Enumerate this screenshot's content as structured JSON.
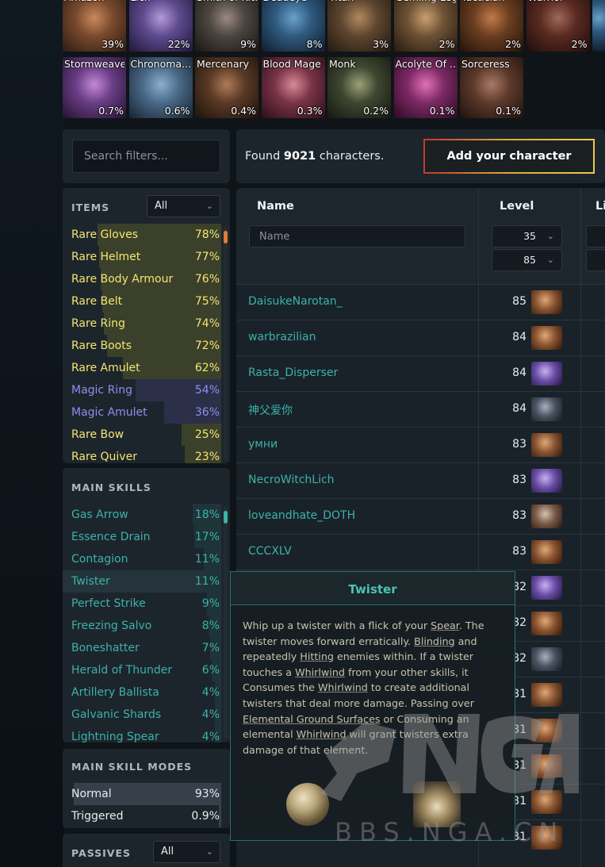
{
  "classes_row1": [
    {
      "name": "Amazon",
      "pct": "39%"
    },
    {
      "name": "Lich",
      "pct": "22%"
    },
    {
      "name": "Smith of Kitava",
      "pct": "9%"
    },
    {
      "name": "Deadeye",
      "pct": "8%"
    },
    {
      "name": "Titan",
      "pct": "3%"
    },
    {
      "name": "Gemling Legionnaire",
      "pct": "2%"
    },
    {
      "name": "Tactician",
      "pct": "2%"
    },
    {
      "name": "Warrior",
      "pct": "2%"
    }
  ],
  "classes_row2": [
    {
      "name": "Stormweaver",
      "pct": "0.7%"
    },
    {
      "name": "Chronoma...",
      "pct": "0.6%"
    },
    {
      "name": "Mercenary",
      "pct": "0.4%"
    },
    {
      "name": "Blood Mage",
      "pct": "0.3%"
    },
    {
      "name": "Monk",
      "pct": "0.2%"
    },
    {
      "name": "Acolyte Of ...",
      "pct": "0.1%"
    },
    {
      "name": "Sorceress",
      "pct": "0.1%"
    }
  ],
  "search": {
    "placeholder": "Search filters..."
  },
  "found": {
    "prefix": "Found ",
    "count": "9021",
    "suffix": " characters."
  },
  "add_button": "Add your character",
  "items": {
    "title": "ITEMS",
    "filter": "All",
    "rows": [
      {
        "label": "Rare Gloves",
        "value": "78%",
        "pct": 78,
        "kind": "rare"
      },
      {
        "label": "Rare Helmet",
        "value": "77%",
        "pct": 77,
        "kind": "rare"
      },
      {
        "label": "Rare Body Armour",
        "value": "76%",
        "pct": 76,
        "kind": "rare"
      },
      {
        "label": "Rare Belt",
        "value": "75%",
        "pct": 75,
        "kind": "rare"
      },
      {
        "label": "Rare Ring",
        "value": "74%",
        "pct": 74,
        "kind": "rare"
      },
      {
        "label": "Rare Boots",
        "value": "72%",
        "pct": 72,
        "kind": "rare"
      },
      {
        "label": "Rare Amulet",
        "value": "62%",
        "pct": 62,
        "kind": "rare"
      },
      {
        "label": "Magic Ring",
        "value": "54%",
        "pct": 54,
        "kind": "magic"
      },
      {
        "label": "Magic Amulet",
        "value": "36%",
        "pct": 36,
        "kind": "magic"
      },
      {
        "label": "Rare Bow",
        "value": "25%",
        "pct": 25,
        "kind": "rare"
      },
      {
        "label": "Rare Quiver",
        "value": "23%",
        "pct": 23,
        "kind": "rare"
      }
    ]
  },
  "main_skills": {
    "title": "MAIN SKILLS",
    "rows": [
      {
        "label": "Gas Arrow",
        "value": "18%",
        "pct": 18
      },
      {
        "label": "Essence Drain",
        "value": "17%",
        "pct": 17
      },
      {
        "label": "Contagion",
        "value": "11%",
        "pct": 11
      },
      {
        "label": "Twister",
        "value": "11%",
        "pct": 11
      },
      {
        "label": "Perfect Strike",
        "value": "9%",
        "pct": 9
      },
      {
        "label": "Freezing Salvo",
        "value": "8%",
        "pct": 8
      },
      {
        "label": "Boneshatter",
        "value": "7%",
        "pct": 7
      },
      {
        "label": "Herald of Thunder",
        "value": "6%",
        "pct": 6
      },
      {
        "label": "Artillery Ballista",
        "value": "4%",
        "pct": 4
      },
      {
        "label": "Galvanic Shards",
        "value": "4%",
        "pct": 4
      },
      {
        "label": "Lightning Spear",
        "value": "4%",
        "pct": 4
      }
    ]
  },
  "modes": {
    "title": "MAIN SKILL MODES",
    "rows": [
      {
        "label": "Normal",
        "value": "93%",
        "pct": 93
      },
      {
        "label": "Triggered",
        "value": "0.9%",
        "pct": 0.9
      }
    ]
  },
  "passives": {
    "title": "PASSIVES",
    "filter": "All"
  },
  "table": {
    "col_name": "Name",
    "col_level": "Level",
    "col_life": "Li",
    "name_placeholder": "Name",
    "level_min": "35",
    "level_max": "85",
    "rows": [
      {
        "name": "DaisukeNarotan_",
        "level": "85",
        "avatar": "warrior"
      },
      {
        "name": "warbrazilian",
        "level": "84",
        "avatar": "warrior"
      },
      {
        "name": "Rasta_Disperser",
        "level": "84",
        "avatar": "lich"
      },
      {
        "name": "神父爱你",
        "level": "84",
        "avatar": "smith"
      },
      {
        "name": "умни",
        "level": "83",
        "avatar": "warrior"
      },
      {
        "name": "NecroWitchLich",
        "level": "83",
        "avatar": "lich"
      },
      {
        "name": "loveandhate_DOTH",
        "level": "83",
        "avatar": "monk"
      },
      {
        "name": "CCCXLV",
        "level": "83",
        "avatar": "warrior"
      },
      {
        "name": "",
        "level": "82",
        "avatar": "lich"
      },
      {
        "name": "",
        "level": "82",
        "avatar": "warrior"
      },
      {
        "name": "",
        "level": "82",
        "avatar": "smith"
      },
      {
        "name": "",
        "level": "81",
        "avatar": "warrior"
      },
      {
        "name": "",
        "level": "81",
        "avatar": "warrior"
      },
      {
        "name": "",
        "level": "81",
        "avatar": "warrior"
      },
      {
        "name": "",
        "level": "81",
        "avatar": "warrior"
      },
      {
        "name": "",
        "level": "81",
        "avatar": "warrior"
      }
    ]
  },
  "tooltip": {
    "title": "Twister",
    "segments": [
      {
        "t": "Whip up a twister with a flick of your "
      },
      {
        "t": "Spear",
        "u": true
      },
      {
        "t": ". The twister moves forward erratically. "
      },
      {
        "t": "Blinding",
        "u": true
      },
      {
        "t": " and repeatedly "
      },
      {
        "t": "Hitting",
        "u": true
      },
      {
        "t": " enemies within. If a twister touches a "
      },
      {
        "t": "Whirlwind",
        "u": true
      },
      {
        "t": " from your other skills, it Consumes the "
      },
      {
        "t": "Whirlwind",
        "u": true
      },
      {
        "t": " to create additional twisters that deal more damage. Passing over "
      },
      {
        "t": "Elemental Ground Surfaces",
        "u": true
      },
      {
        "t": " or Consuming an elemental "
      },
      {
        "t": "Whirlwind",
        "u": true
      },
      {
        "t": " will grant twisters extra damage of that element."
      }
    ]
  },
  "watermark": {
    "text": "BBS.NGA.CN"
  },
  "colors": {
    "rare": "#f3e573",
    "magic": "#8c8ff0",
    "skill": "#3bb3a9",
    "accent": "#e0a93a"
  }
}
